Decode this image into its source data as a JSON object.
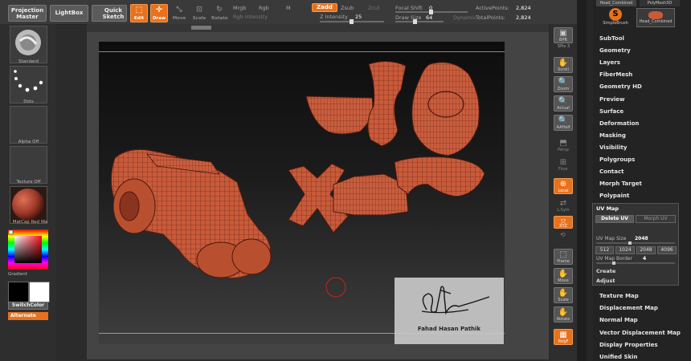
{
  "toolbar": {
    "projection_master": [
      "Projection",
      "Master"
    ],
    "lightbox": "LightBox",
    "quick_sketch": [
      "Quick",
      "Sketch"
    ],
    "edit": "Edit",
    "draw": "Draw",
    "move": "Move",
    "scale": "Scale",
    "rotate": "Rotate",
    "mrgb": "Mrgb",
    "rgb": "Rgb",
    "m": "M",
    "rgb_intensity": "Rgb Intensity",
    "zadd": "Zadd",
    "zsub": "Zsub",
    "zcut": "Zcut",
    "z_intensity_label": "Z Intensity",
    "z_intensity_value": "25",
    "z_intensity_fraction": 0.25,
    "focal_shift_label": "Focal Shift",
    "focal_shift_value": "0",
    "draw_size_label": "Draw Size",
    "draw_size_value": "64",
    "dynamic": "Dynamic",
    "active_points_label": "ActivePoints:",
    "active_points_value": "2,824",
    "total_points_label": "TotalPoints:",
    "total_points_value": "2,824"
  },
  "left_panel": {
    "standard": "Standard",
    "dots": "Dots",
    "alpha_off": "Alpha Off",
    "texture_off": "Texture Off",
    "matcap": "MatCap Red Wa",
    "gradient": "Gradient",
    "switch_color": "SwitchColor",
    "alternate": "Alternate"
  },
  "right_shelf": {
    "bpr": "BPR",
    "spix": "SPix 3",
    "scroll": "Scroll",
    "zoom": "Zoom",
    "actual": "Actual",
    "aahalf": "AAHalf",
    "persp": "Persp",
    "floor": "Floor",
    "local": "Local",
    "lsym": "L.Sym",
    "xyz": "XYZ",
    "frame": "Frame",
    "move": "Move",
    "scale": "Scale",
    "rotate": "Rotate",
    "polyf": "PolyF"
  },
  "menu": {
    "top_buttons": [
      "Head_Combined",
      "PolyMesh3D"
    ],
    "simple_brush": "SimpleBrush",
    "head_combined": "Head_Combined",
    "items_top": [
      "SubTool",
      "Geometry",
      "Layers",
      "FiberMesh",
      "Geometry HD",
      "Preview",
      "Surface",
      "Deformation",
      "Masking",
      "Visibility",
      "Polygroups",
      "Contact",
      "Morph Target",
      "Polypaint"
    ],
    "uv_map": {
      "title": "UV Map",
      "delete_uv": "Delete UV",
      "morph_uv": "Morph UV",
      "uv_map_size_label": "UV Map Size",
      "uv_map_size_value": "2048",
      "sizes": [
        "512",
        "1024",
        "2048",
        "4096"
      ],
      "uv_map_border_label": "UV Map Border",
      "uv_map_border_value": "4",
      "create": "Create",
      "adjust": "Adjust"
    },
    "items_bottom": [
      "Texture Map",
      "Displacement Map",
      "Normal Map",
      "Vector Displacement Map",
      "Display Properties",
      "Unified Skin"
    ]
  },
  "watermark": {
    "name": "Fahad Hasan Pathik"
  },
  "colors": {
    "accent": "#e8711d",
    "mesh": "#c85a3a",
    "panel": "#2e2e2e"
  }
}
